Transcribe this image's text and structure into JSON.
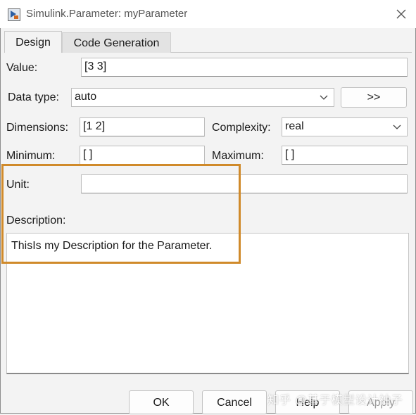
{
  "window": {
    "title": "Simulink.Parameter: myParameter"
  },
  "tabs": [
    {
      "label": "Design"
    },
    {
      "label": "Code Generation"
    }
  ],
  "design": {
    "value_label": "Value:",
    "value": "[3 3]",
    "datatype_label": "Data type:",
    "datatype_value": "auto",
    "datatype_more_button": ">>",
    "dimensions_label": "Dimensions:",
    "dimensions_value": "[1 2]",
    "complexity_label": "Complexity:",
    "complexity_value": "real",
    "minimum_label": "Minimum:",
    "minimum_value": "[ ]",
    "maximum_label": "Maximum:",
    "maximum_value": "[ ]",
    "unit_label": "Unit:",
    "unit_value": "",
    "description_label": "Description:",
    "description_value": "ThisIs my Description for the Parameter."
  },
  "buttons": {
    "ok": "OK",
    "cancel": "Cancel",
    "help": "Help",
    "apply": "Apply"
  },
  "watermark": "知乎 @基于模型设计袖子",
  "colors": {
    "highlight": "#d08a2a",
    "background": "#f3f3f3"
  },
  "icons": {
    "app": "simulink-parameter-icon",
    "close": "close-icon",
    "dropdown": "chevron-down-icon"
  }
}
